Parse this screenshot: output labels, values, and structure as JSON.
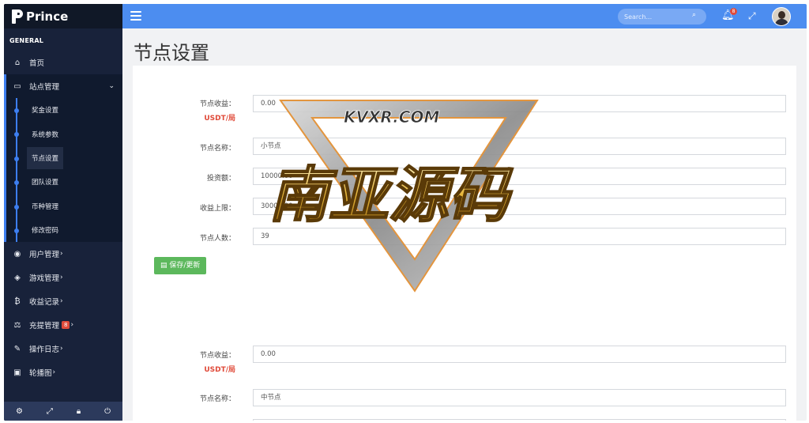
{
  "brand": {
    "name": "Prince"
  },
  "sidebar": {
    "section": "GENERAL",
    "home": "首页",
    "site": {
      "label": "站点管理",
      "children": [
        "奖金设置",
        "系统参数",
        "节点设置",
        "团队设置",
        "币种管理",
        "修改密码"
      ],
      "active": "节点设置"
    },
    "items": [
      {
        "label": "用户管理",
        "icon": "user-circle-icon"
      },
      {
        "label": "游戏管理",
        "icon": "cube-icon"
      },
      {
        "label": "收益记录",
        "icon": "bitcoin-icon"
      },
      {
        "label": "充提管理",
        "icon": "balance-scale-icon",
        "badge": "8"
      },
      {
        "label": "操作日志",
        "icon": "edit-icon"
      },
      {
        "label": "轮播图",
        "icon": "image-icon"
      }
    ]
  },
  "topbar": {
    "search_placeholder": "Search...",
    "notification_count": "8"
  },
  "page": {
    "title": "节点设置"
  },
  "form1": {
    "income_label": "节点收益：",
    "income_unit": "USDT/局",
    "income_value": "0.00",
    "name_label": "节点名称：",
    "name_value": "小节点",
    "invest_label": "投资额：",
    "invest_value": "10000.00",
    "limit_label": "收益上限：",
    "limit_value": "30000.00",
    "count_label": "节点人数：",
    "count_value": "39",
    "save_label": "保存/更新"
  },
  "form2": {
    "income_label": "节点收益：",
    "income_unit": "USDT/局",
    "income_value": "0.00",
    "name_label": "节点名称：",
    "name_value": "中节点"
  },
  "watermark": {
    "site": "KVXR.COM",
    "text": "南亚源码"
  },
  "colors": {
    "topbar": "#4c8df0",
    "sidebar": "#18223a",
    "accent": "#3d7ef0",
    "save": "#5cb85c",
    "unit": "#e04b3a"
  }
}
